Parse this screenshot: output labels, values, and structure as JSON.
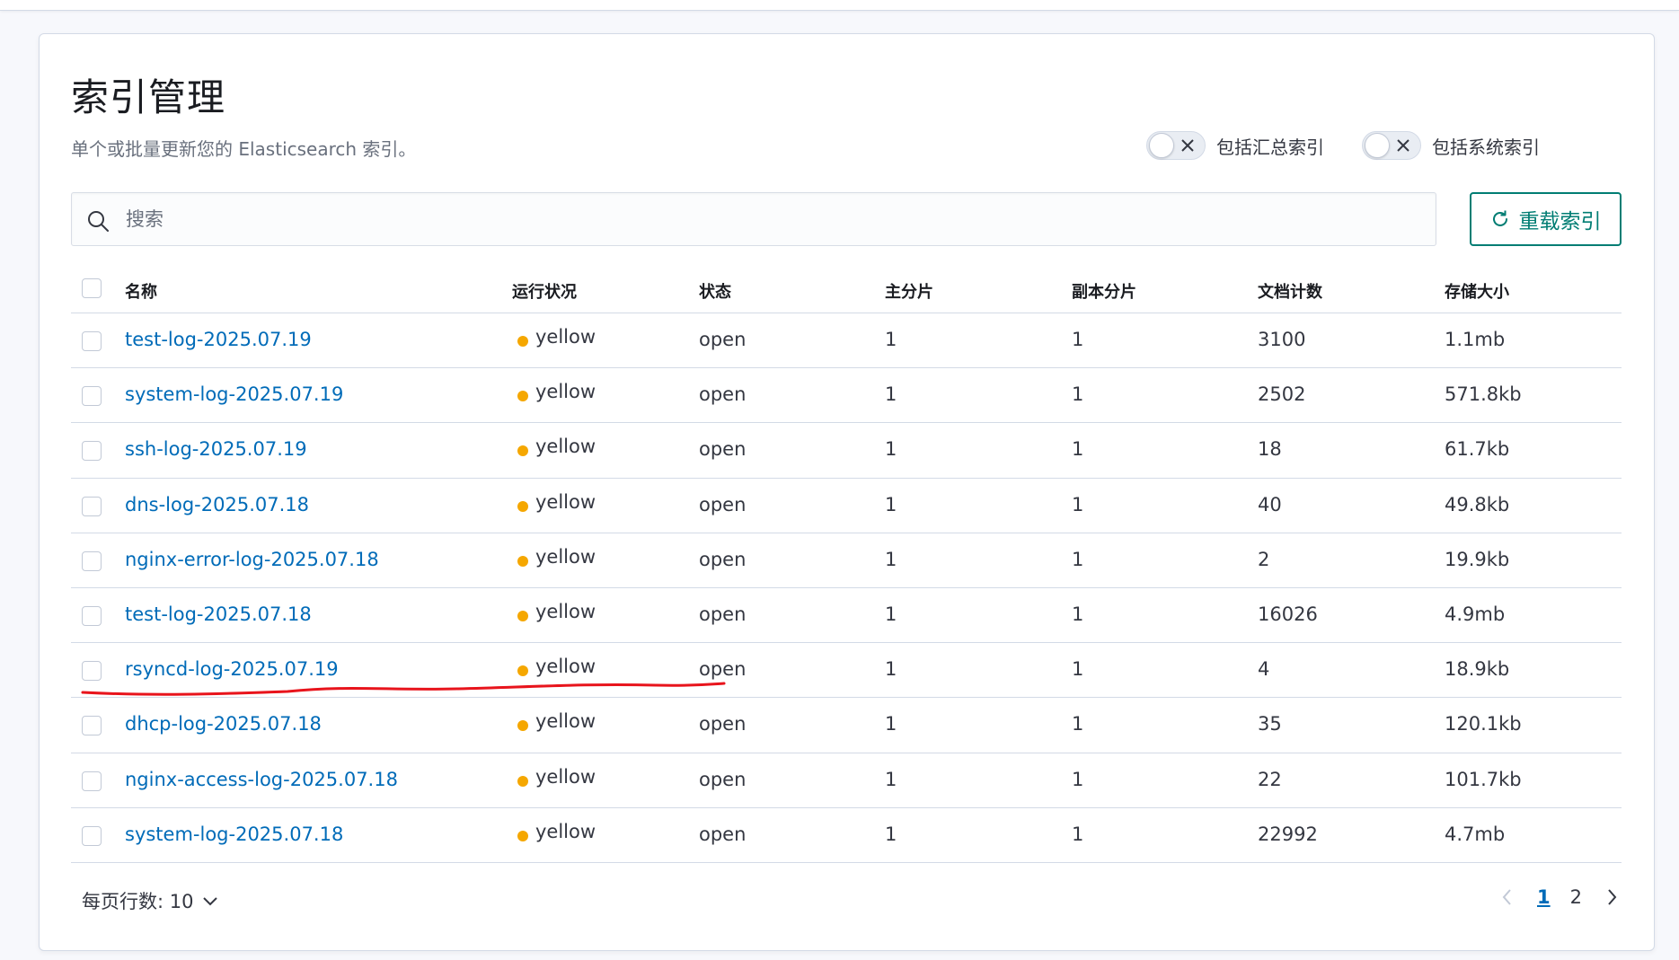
{
  "header": {
    "title": "索引管理",
    "description": "单个或批量更新您的 Elasticsearch 索引。"
  },
  "toggles": [
    {
      "label": "包括汇总索引",
      "on": false
    },
    {
      "label": "包括系统索引",
      "on": false
    }
  ],
  "search": {
    "placeholder": "搜索",
    "value": ""
  },
  "reload_button": {
    "label": "重载索引"
  },
  "table": {
    "columns": [
      "名称",
      "运行状况",
      "状态",
      "主分片",
      "副本分片",
      "文档计数",
      "存储大小"
    ],
    "rows": [
      {
        "name": "test-log-2025.07.19",
        "health": "yellow",
        "status": "open",
        "primary": "1",
        "replica": "1",
        "docs": "3100",
        "size": "1.1mb"
      },
      {
        "name": "system-log-2025.07.19",
        "health": "yellow",
        "status": "open",
        "primary": "1",
        "replica": "1",
        "docs": "2502",
        "size": "571.8kb"
      },
      {
        "name": "ssh-log-2025.07.19",
        "health": "yellow",
        "status": "open",
        "primary": "1",
        "replica": "1",
        "docs": "18",
        "size": "61.7kb"
      },
      {
        "name": "dns-log-2025.07.18",
        "health": "yellow",
        "status": "open",
        "primary": "1",
        "replica": "1",
        "docs": "40",
        "size": "49.8kb"
      },
      {
        "name": "nginx-error-log-2025.07.18",
        "health": "yellow",
        "status": "open",
        "primary": "1",
        "replica": "1",
        "docs": "2",
        "size": "19.9kb"
      },
      {
        "name": "test-log-2025.07.18",
        "health": "yellow",
        "status": "open",
        "primary": "1",
        "replica": "1",
        "docs": "16026",
        "size": "4.9mb"
      },
      {
        "name": "rsyncd-log-2025.07.19",
        "health": "yellow",
        "status": "open",
        "primary": "1",
        "replica": "1",
        "docs": "4",
        "size": "18.9kb"
      },
      {
        "name": "dhcp-log-2025.07.18",
        "health": "yellow",
        "status": "open",
        "primary": "1",
        "replica": "1",
        "docs": "35",
        "size": "120.1kb"
      },
      {
        "name": "nginx-access-log-2025.07.18",
        "health": "yellow",
        "status": "open",
        "primary": "1",
        "replica": "1",
        "docs": "22",
        "size": "101.7kb"
      },
      {
        "name": "system-log-2025.07.18",
        "health": "yellow",
        "status": "open",
        "primary": "1",
        "replica": "1",
        "docs": "22992",
        "size": "4.7mb"
      }
    ]
  },
  "footer": {
    "rows_per_page": "每页行数: 10",
    "pages": [
      "1",
      "2"
    ],
    "current_page": "1"
  },
  "colors": {
    "link": "#006bb8",
    "health_yellow": "#f5a700",
    "accent": "#017d73",
    "annotation": "#e8141c"
  },
  "icons": [
    "x-icon",
    "search-icon",
    "refresh-icon",
    "chevron-down-icon",
    "chevron-left-icon",
    "chevron-right-icon"
  ]
}
